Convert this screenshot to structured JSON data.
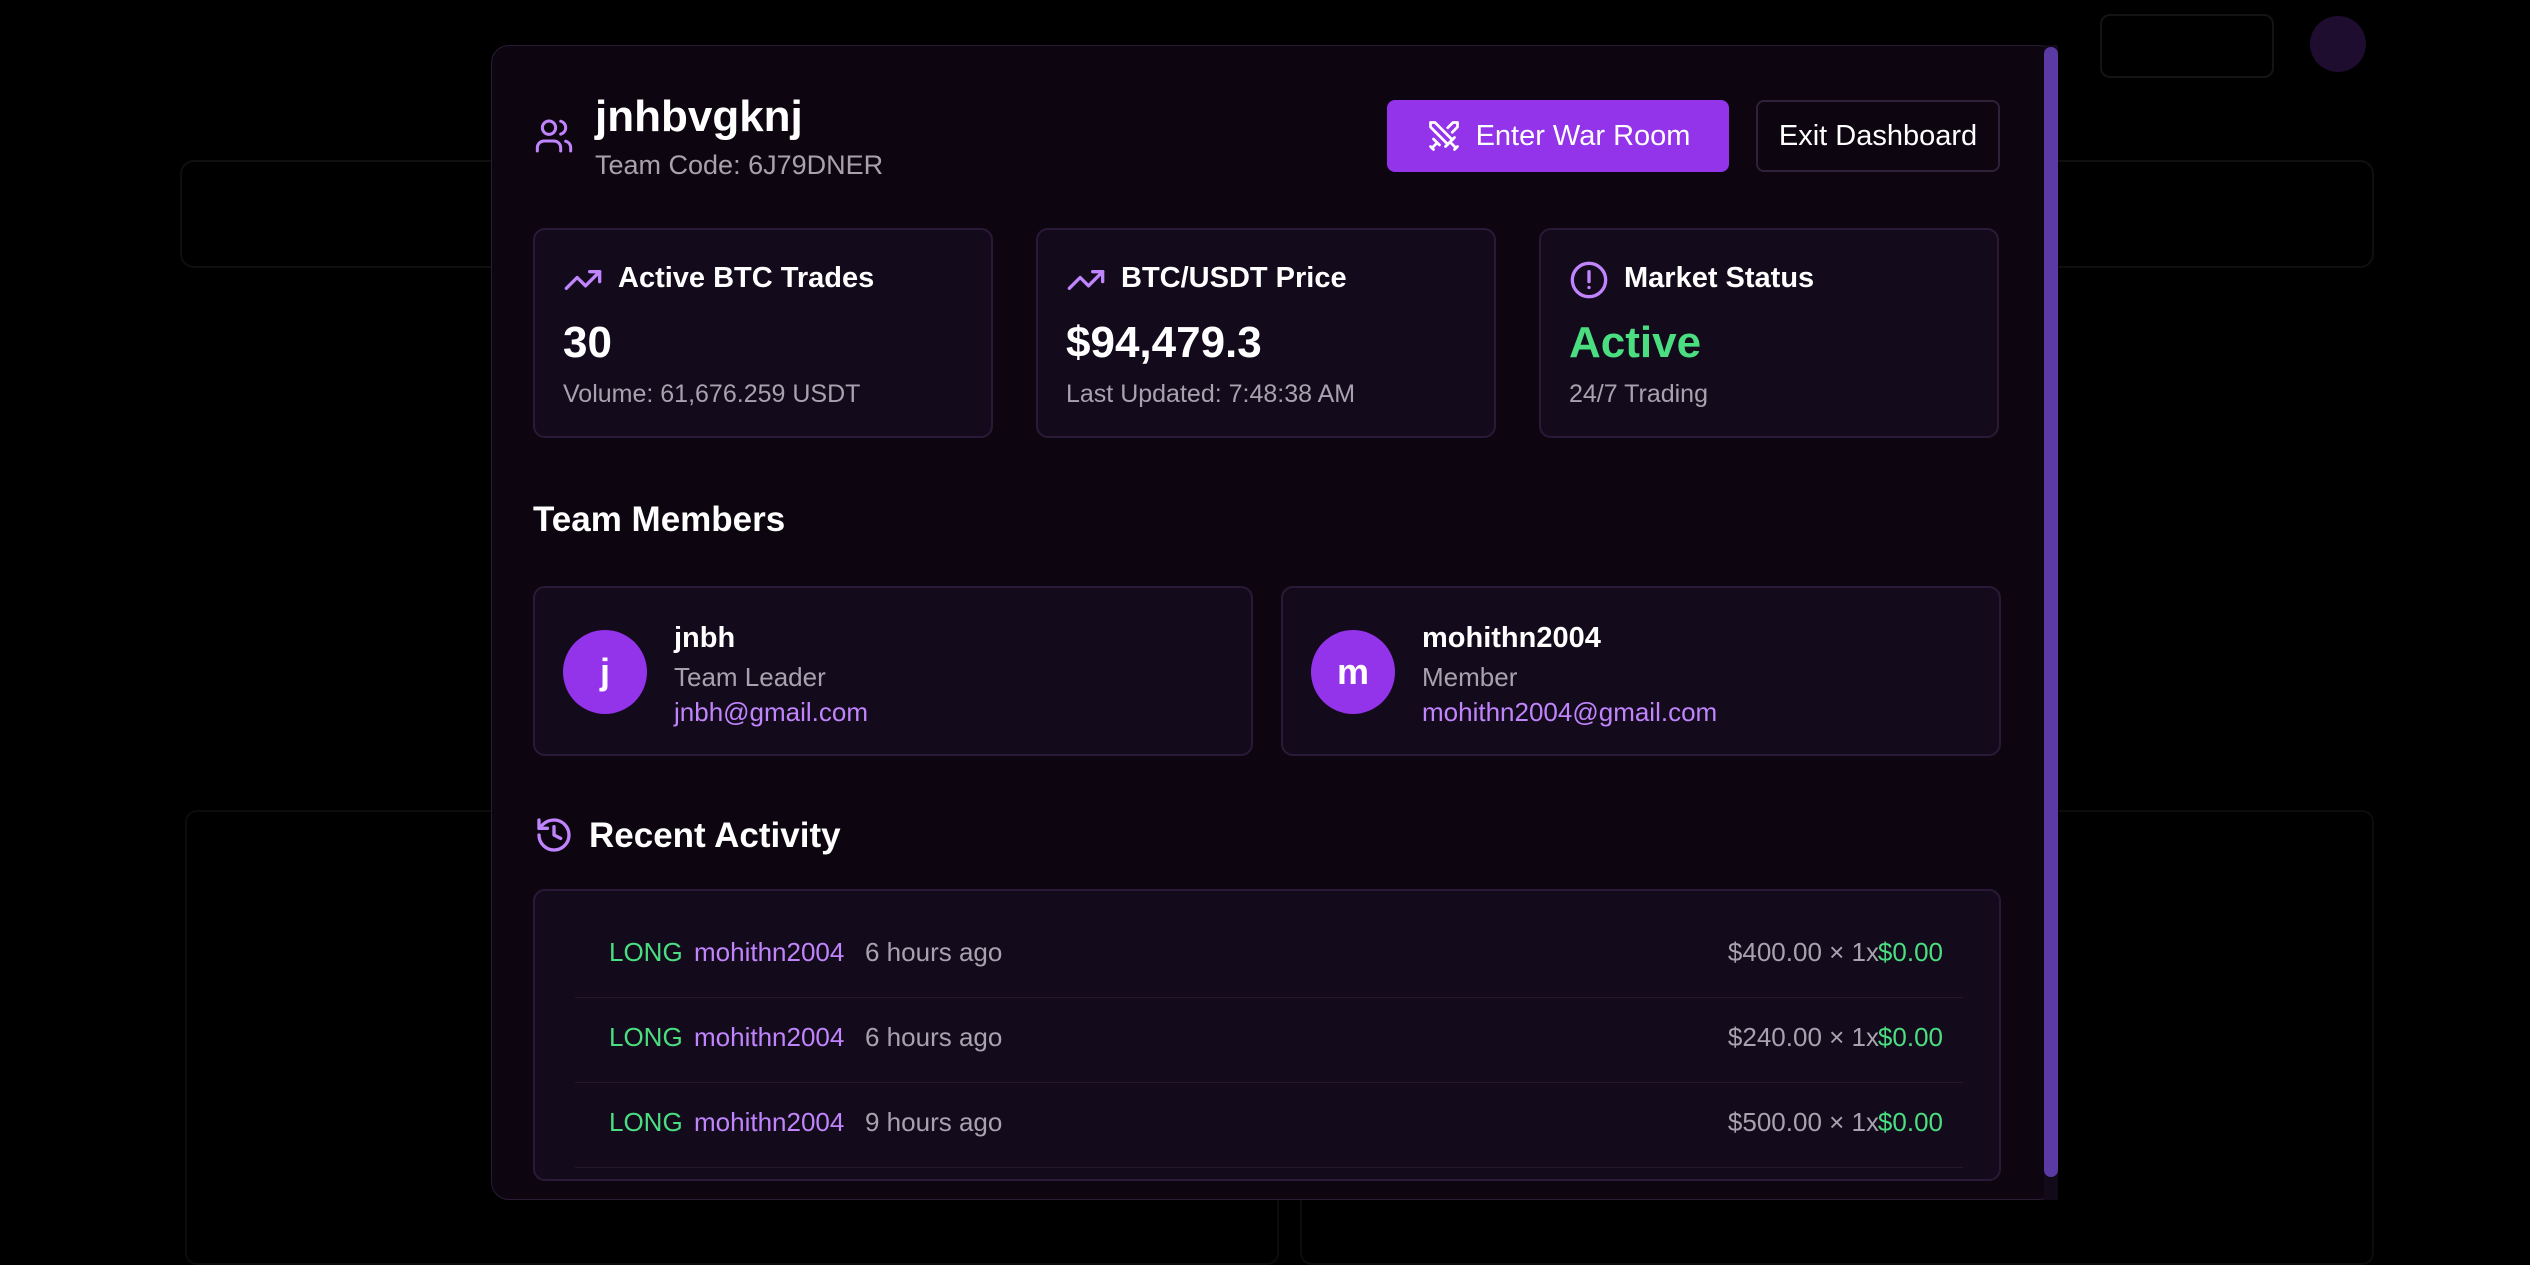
{
  "team": {
    "name": "jnhbvgknj",
    "code_label": "Team Code: 6J79DNER"
  },
  "buttons": {
    "war_room": "Enter War Room",
    "exit": "Exit Dashboard"
  },
  "stats": [
    {
      "label": "Active BTC Trades",
      "value": "30",
      "sub": "Volume: 61,676.259 USDT",
      "icon": "trending-up-icon"
    },
    {
      "label": "BTC/USDT Price",
      "value": "$94,479.3",
      "sub": "Last Updated: 7:48:38 AM",
      "icon": "trending-up-icon"
    },
    {
      "label": "Market Status",
      "value": "Active",
      "sub": "24/7 Trading",
      "icon": "alert-circle-icon"
    }
  ],
  "members_section": {
    "title": "Team Members"
  },
  "members": [
    {
      "initial": "j",
      "name": "jnbh",
      "role": "Team Leader",
      "email": "jnbh@gmail.com"
    },
    {
      "initial": "m",
      "name": "mohithn2004",
      "role": "Member",
      "email": "mohithn2004@gmail.com"
    }
  ],
  "activity_section": {
    "title": "Recent Activity"
  },
  "activity": [
    {
      "type": "LONG",
      "user": "mohithn2004",
      "time": "6 hours ago",
      "amount": "$400.00 × 1x",
      "pnl": "$0.00"
    },
    {
      "type": "LONG",
      "user": "mohithn2004",
      "time": "6 hours ago",
      "amount": "$240.00 × 1x",
      "pnl": "$0.00"
    },
    {
      "type": "LONG",
      "user": "mohithn2004",
      "time": "9 hours ago",
      "amount": "$500.00 × 1x",
      "pnl": "$0.00"
    }
  ],
  "colors": {
    "accent": "#9333ea",
    "accent_light": "#c084fc",
    "positive": "#4ade80",
    "modal_bg": "#0d0610"
  }
}
